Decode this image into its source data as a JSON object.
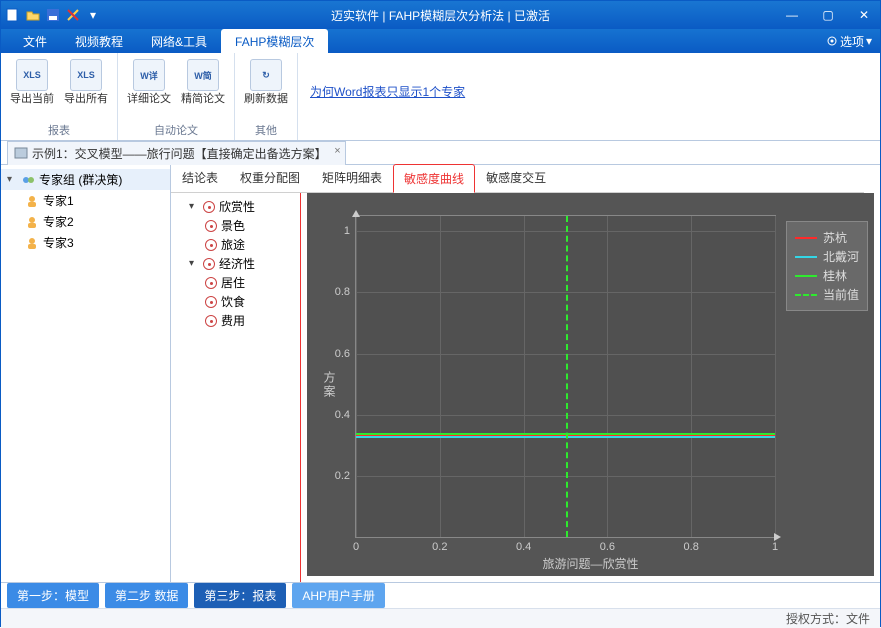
{
  "titlebar": {
    "title": "迈实软件 | FAHP模糊层次分析法 | 已激活"
  },
  "menu": {
    "items": [
      "文件",
      "视频教程",
      "网络&工具",
      "FAHP模糊层次"
    ],
    "activeIndex": 3,
    "options": "选项"
  },
  "ribbon": {
    "groups": [
      {
        "label": "报表",
        "buttons": [
          {
            "icon": "XLS",
            "text": "导出当前"
          },
          {
            "icon": "XLS",
            "text": "导出所有"
          }
        ]
      },
      {
        "label": "自动论文",
        "buttons": [
          {
            "icon": "W详",
            "text": "详细论文"
          },
          {
            "icon": "W简",
            "text": "精简论文"
          }
        ]
      },
      {
        "label": "其他",
        "buttons": [
          {
            "icon": "↻",
            "text": "刷新数据"
          }
        ]
      }
    ],
    "link": "为何Word报表只显示1个专家"
  },
  "doctab": {
    "title": "示例1：交叉模型——旅行问题【直接确定出备选方案】"
  },
  "sidebar": {
    "root": "专家组 (群决策)",
    "children": [
      "专家1",
      "专家2",
      "专家3"
    ]
  },
  "innerTabs": {
    "items": [
      "结论表",
      "权重分配图",
      "矩阵明细表",
      "敏感度曲线",
      "敏感度交互"
    ],
    "activeIndex": 3
  },
  "paramTree": [
    {
      "label": "欣赏性",
      "children": [
        "景色",
        "旅途"
      ]
    },
    {
      "label": "经济性",
      "children": [
        "居住",
        "饮食",
        "费用"
      ]
    }
  ],
  "chart_data": {
    "type": "line",
    "xlabel": "旅游问题—欣赏性",
    "ylabel": "方案",
    "xlim": [
      0,
      1
    ],
    "ylim": [
      0,
      1.05
    ],
    "xticks": [
      0,
      0.2,
      0.4,
      0.6,
      0.8,
      1
    ],
    "yticks": [
      0.2,
      0.4,
      0.6,
      0.8,
      1
    ],
    "series": [
      {
        "name": "苏杭",
        "color": "#ff2a2a",
        "type": "line",
        "x": [
          0,
          1
        ],
        "y": [
          0.335,
          0.335
        ]
      },
      {
        "name": "北戴河",
        "color": "#33d6e6",
        "type": "line",
        "x": [
          0,
          1
        ],
        "y": [
          0.33,
          0.33
        ]
      },
      {
        "name": "桂林",
        "color": "#2eea2e",
        "type": "line",
        "x": [
          0,
          1
        ],
        "y": [
          0.34,
          0.34
        ]
      },
      {
        "name": "当前值",
        "color": "#2eea2e",
        "type": "vline",
        "x": 0.5
      }
    ]
  },
  "steps": {
    "a": "第一步：模型",
    "b": "第二步 数据",
    "c": "第三步：报表",
    "d": "AHP用户手册"
  },
  "status": "授权方式：文件"
}
